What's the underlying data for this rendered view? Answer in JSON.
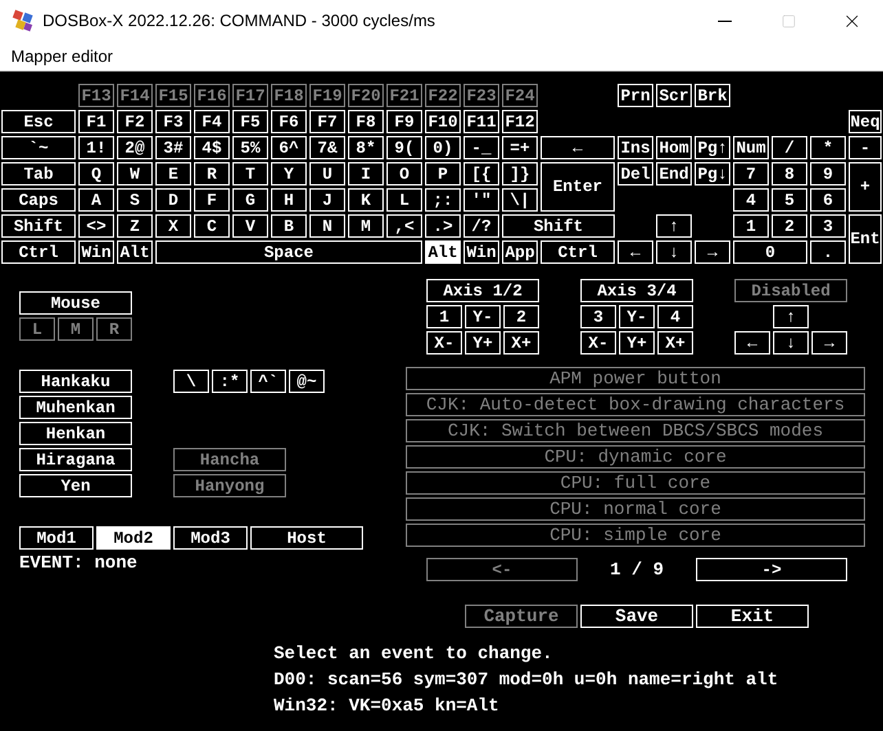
{
  "window": {
    "title": "DOSBox-X 2022.12.26: COMMAND - 3000 cycles/ms"
  },
  "menu_bar": {
    "items": [
      "Mapper editor"
    ]
  },
  "keyboard": {
    "rows": [
      {
        "keys": [
          {
            "label": "F13",
            "disabled": true,
            "selected": false
          },
          {
            "label": "F14",
            "disabled": true,
            "selected": false
          },
          {
            "label": "F15",
            "disabled": true,
            "selected": false
          },
          {
            "label": "F16",
            "disabled": true,
            "selected": false
          },
          {
            "label": "F17",
            "disabled": true,
            "selected": false
          },
          {
            "label": "F18",
            "disabled": true,
            "selected": false
          },
          {
            "label": "F19",
            "disabled": true,
            "selected": false
          },
          {
            "label": "F20",
            "disabled": true,
            "selected": false
          },
          {
            "label": "F21",
            "disabled": true,
            "selected": false
          },
          {
            "label": "F22",
            "disabled": true,
            "selected": false
          },
          {
            "label": "F23",
            "disabled": true,
            "selected": false
          },
          {
            "label": "F24",
            "disabled": true,
            "selected": false
          },
          {
            "label": "Prn",
            "disabled": false,
            "selected": false
          },
          {
            "label": "Scr",
            "disabled": false,
            "selected": false
          },
          {
            "label": "Brk",
            "disabled": false,
            "selected": false
          }
        ]
      },
      {
        "keys": [
          {
            "label": "Esc",
            "disabled": false,
            "selected": false
          },
          {
            "label": "F1",
            "disabled": false,
            "selected": false
          },
          {
            "label": "F2",
            "disabled": false,
            "selected": false
          },
          {
            "label": "F3",
            "disabled": false,
            "selected": false
          },
          {
            "label": "F4",
            "disabled": false,
            "selected": false
          },
          {
            "label": "F5",
            "disabled": false,
            "selected": false
          },
          {
            "label": "F6",
            "disabled": false,
            "selected": false
          },
          {
            "label": "F7",
            "disabled": false,
            "selected": false
          },
          {
            "label": "F8",
            "disabled": false,
            "selected": false
          },
          {
            "label": "F9",
            "disabled": false,
            "selected": false
          },
          {
            "label": "F10",
            "disabled": false,
            "selected": false
          },
          {
            "label": "F11",
            "disabled": false,
            "selected": false
          },
          {
            "label": "F12",
            "disabled": false,
            "selected": false
          },
          {
            "label": "Neq",
            "disabled": false,
            "selected": false
          }
        ]
      },
      {
        "keys": [
          {
            "label": "`~",
            "disabled": false,
            "selected": false
          },
          {
            "label": "1!",
            "disabled": false,
            "selected": false
          },
          {
            "label": "2@",
            "disabled": false,
            "selected": false
          },
          {
            "label": "3#",
            "disabled": false,
            "selected": false
          },
          {
            "label": "4$",
            "disabled": false,
            "selected": false
          },
          {
            "label": "5%",
            "disabled": false,
            "selected": false
          },
          {
            "label": "6^",
            "disabled": false,
            "selected": false
          },
          {
            "label": "7&",
            "disabled": false,
            "selected": false
          },
          {
            "label": "8*",
            "disabled": false,
            "selected": false
          },
          {
            "label": "9(",
            "disabled": false,
            "selected": false
          },
          {
            "label": "0)",
            "disabled": false,
            "selected": false
          },
          {
            "label": "-_",
            "disabled": false,
            "selected": false
          },
          {
            "label": "=+",
            "disabled": false,
            "selected": false
          },
          {
            "label": "←",
            "disabled": false,
            "selected": false
          },
          {
            "label": "Ins",
            "disabled": false,
            "selected": false
          },
          {
            "label": "Hom",
            "disabled": false,
            "selected": false
          },
          {
            "label": "Pg↑",
            "disabled": false,
            "selected": false
          },
          {
            "label": "Num",
            "disabled": false,
            "selected": false
          },
          {
            "label": "/",
            "disabled": false,
            "selected": false
          },
          {
            "label": "*",
            "disabled": false,
            "selected": false
          },
          {
            "label": "-",
            "disabled": false,
            "selected": false
          }
        ]
      },
      {
        "keys": [
          {
            "label": "Tab",
            "disabled": false,
            "selected": false
          },
          {
            "label": "Q",
            "disabled": false,
            "selected": false
          },
          {
            "label": "W",
            "disabled": false,
            "selected": false
          },
          {
            "label": "E",
            "disabled": false,
            "selected": false
          },
          {
            "label": "R",
            "disabled": false,
            "selected": false
          },
          {
            "label": "T",
            "disabled": false,
            "selected": false
          },
          {
            "label": "Y",
            "disabled": false,
            "selected": false
          },
          {
            "label": "U",
            "disabled": false,
            "selected": false
          },
          {
            "label": "I",
            "disabled": false,
            "selected": false
          },
          {
            "label": "O",
            "disabled": false,
            "selected": false
          },
          {
            "label": "P",
            "disabled": false,
            "selected": false
          },
          {
            "label": "[{",
            "disabled": false,
            "selected": false
          },
          {
            "label": "]}",
            "disabled": false,
            "selected": false
          },
          {
            "label": "Enter",
            "disabled": false,
            "selected": false
          },
          {
            "label": "Del",
            "disabled": false,
            "selected": false
          },
          {
            "label": "End",
            "disabled": false,
            "selected": false
          },
          {
            "label": "Pg↓",
            "disabled": false,
            "selected": false
          },
          {
            "label": "7",
            "disabled": false,
            "selected": false
          },
          {
            "label": "8",
            "disabled": false,
            "selected": false
          },
          {
            "label": "9",
            "disabled": false,
            "selected": false
          },
          {
            "label": "+",
            "disabled": false,
            "selected": false
          }
        ]
      },
      {
        "keys": [
          {
            "label": "Caps",
            "disabled": false,
            "selected": false
          },
          {
            "label": "A",
            "disabled": false,
            "selected": false
          },
          {
            "label": "S",
            "disabled": false,
            "selected": false
          },
          {
            "label": "D",
            "disabled": false,
            "selected": false
          },
          {
            "label": "F",
            "disabled": false,
            "selected": false
          },
          {
            "label": "G",
            "disabled": false,
            "selected": false
          },
          {
            "label": "H",
            "disabled": false,
            "selected": false
          },
          {
            "label": "J",
            "disabled": false,
            "selected": false
          },
          {
            "label": "K",
            "disabled": false,
            "selected": false
          },
          {
            "label": "L",
            "disabled": false,
            "selected": false
          },
          {
            "label": ";:",
            "disabled": false,
            "selected": false
          },
          {
            "label": "'\"",
            "disabled": false,
            "selected": false
          },
          {
            "label": "\\|",
            "disabled": false,
            "selected": false
          },
          {
            "label": "4",
            "disabled": false,
            "selected": false
          },
          {
            "label": "5",
            "disabled": false,
            "selected": false
          },
          {
            "label": "6",
            "disabled": false,
            "selected": false
          }
        ]
      },
      {
        "keys": [
          {
            "label": "Shift",
            "disabled": false,
            "selected": false
          },
          {
            "label": "<>",
            "disabled": false,
            "selected": false
          },
          {
            "label": "Z",
            "disabled": false,
            "selected": false
          },
          {
            "label": "X",
            "disabled": false,
            "selected": false
          },
          {
            "label": "C",
            "disabled": false,
            "selected": false
          },
          {
            "label": "V",
            "disabled": false,
            "selected": false
          },
          {
            "label": "B",
            "disabled": false,
            "selected": false
          },
          {
            "label": "N",
            "disabled": false,
            "selected": false
          },
          {
            "label": "M",
            "disabled": false,
            "selected": false
          },
          {
            "label": ",<",
            "disabled": false,
            "selected": false
          },
          {
            "label": ".>",
            "disabled": false,
            "selected": false
          },
          {
            "label": "/?",
            "disabled": false,
            "selected": false
          },
          {
            "label": "Shift",
            "disabled": false,
            "selected": false
          },
          {
            "label": "↑",
            "disabled": false,
            "selected": false
          },
          {
            "label": "1",
            "disabled": false,
            "selected": false
          },
          {
            "label": "2",
            "disabled": false,
            "selected": false
          },
          {
            "label": "3",
            "disabled": false,
            "selected": false
          },
          {
            "label": "Ent",
            "disabled": false,
            "selected": false
          }
        ]
      },
      {
        "keys": [
          {
            "label": "Ctrl",
            "disabled": false,
            "selected": false
          },
          {
            "label": "Win",
            "disabled": false,
            "selected": false
          },
          {
            "label": "Alt",
            "disabled": false,
            "selected": false
          },
          {
            "label": "Space",
            "disabled": false,
            "selected": false
          },
          {
            "label": "Alt",
            "disabled": false,
            "selected": true
          },
          {
            "label": "Win",
            "disabled": false,
            "selected": false
          },
          {
            "label": "App",
            "disabled": false,
            "selected": false
          },
          {
            "label": "Ctrl",
            "disabled": false,
            "selected": false
          },
          {
            "label": "←",
            "disabled": false,
            "selected": false
          },
          {
            "label": "↓",
            "disabled": false,
            "selected": false
          },
          {
            "label": "→",
            "disabled": false,
            "selected": false
          },
          {
            "label": "0",
            "disabled": false,
            "selected": false
          },
          {
            "label": ".",
            "disabled": false,
            "selected": false
          }
        ]
      }
    ]
  },
  "mouse": {
    "label": "Mouse",
    "buttons": [
      {
        "label": "L",
        "disabled": true
      },
      {
        "label": "M",
        "disabled": true
      },
      {
        "label": "R",
        "disabled": true
      }
    ]
  },
  "japanese_keys": [
    "Hankaku",
    "Muhenkan",
    "Henkan",
    "Hiragana",
    "Yen"
  ],
  "extra_keys": [
    "\\",
    ":*",
    "^`",
    "@~"
  ],
  "korean_keys": [
    {
      "label": "Hancha",
      "disabled": true
    },
    {
      "label": "Hanyong",
      "disabled": true
    }
  ],
  "modifiers": [
    {
      "label": "Mod1",
      "selected": false
    },
    {
      "label": "Mod2",
      "selected": true
    },
    {
      "label": "Mod3",
      "selected": false
    },
    {
      "label": "Host",
      "selected": false
    }
  ],
  "event": "EVENT: none",
  "axis_pads": [
    {
      "title": "Axis 1/2",
      "keys": [
        "1",
        "Y-",
        "2",
        "X-",
        "Y+",
        "X+"
      ]
    },
    {
      "title": "Axis 3/4",
      "keys": [
        "3",
        "Y-",
        "4",
        "X-",
        "Y+",
        "X+"
      ]
    }
  ],
  "hat": {
    "title": {
      "label": "Disabled",
      "disabled": true
    },
    "keys": [
      "↑",
      "←",
      "↓",
      "→"
    ]
  },
  "handlers": [
    {
      "label": "APM power button",
      "disabled": true
    },
    {
      "label": "CJK: Auto-detect box-drawing characters",
      "disabled": true
    },
    {
      "label": "CJK: Switch between DBCS/SBCS modes",
      "disabled": true
    },
    {
      "label": "CPU: dynamic core",
      "disabled": true
    },
    {
      "label": "CPU: full core",
      "disabled": true
    },
    {
      "label": "CPU: normal core",
      "disabled": true
    },
    {
      "label": "CPU: simple core",
      "disabled": true
    }
  ],
  "pager": {
    "prev": {
      "label": "<-",
      "disabled": true
    },
    "page": "1 / 9",
    "next": {
      "label": "->",
      "disabled": false
    }
  },
  "actions": [
    {
      "label": "Capture",
      "disabled": true
    },
    {
      "label": "Save",
      "disabled": false
    },
    {
      "label": "Exit",
      "disabled": false
    }
  ],
  "info_lines": [
    "Select an event to change.",
    "D00: scan=56 sym=307 mod=0h u=0h name=right alt",
    "Win32: VK=0xa5 kn=Alt"
  ]
}
